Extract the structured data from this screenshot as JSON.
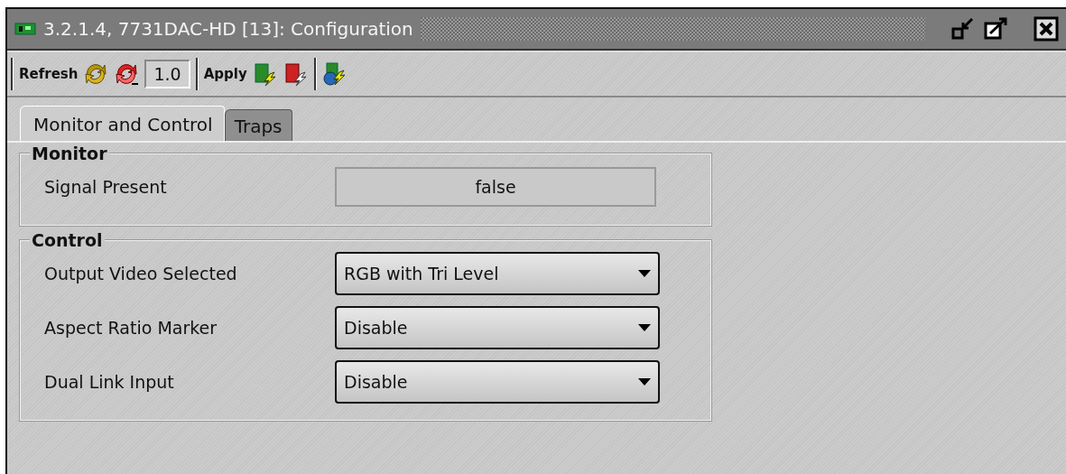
{
  "window": {
    "title": "3.2.1.4, 7731DAC-HD  [13]: Configuration"
  },
  "toolbar": {
    "refresh_label": "Refresh",
    "interval": "1.0",
    "apply_label": "Apply"
  },
  "tabs": [
    {
      "label": "Monitor and Control",
      "selected": true
    },
    {
      "label": "Traps",
      "selected": false
    }
  ],
  "groups": [
    {
      "title": "Monitor",
      "rows": [
        {
          "kind": "readout",
          "label": "Signal Present",
          "value": "false"
        }
      ]
    },
    {
      "title": "Control",
      "rows": [
        {
          "kind": "dropdown",
          "label": "Output Video Selected",
          "value": "RGB with Tri Level"
        },
        {
          "kind": "dropdown",
          "label": "Aspect Ratio Marker",
          "value": "Disable"
        },
        {
          "kind": "dropdown",
          "label": "Dual Link Input",
          "value": "Disable"
        }
      ]
    }
  ]
}
